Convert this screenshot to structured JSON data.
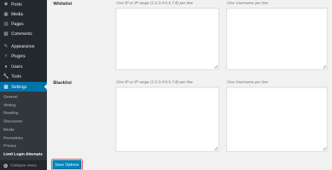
{
  "sidebar": {
    "items": [
      {
        "label": "Posts",
        "icon": "pin-icon"
      },
      {
        "label": "Media",
        "icon": "media-icon"
      },
      {
        "label": "Pages",
        "icon": "page-icon"
      },
      {
        "label": "Comments",
        "icon": "comment-icon"
      },
      {
        "label": "Appearance",
        "icon": "brush-icon"
      },
      {
        "label": "Plugins",
        "icon": "plug-icon"
      },
      {
        "label": "Users",
        "icon": "user-icon"
      },
      {
        "label": "Tools",
        "icon": "wrench-icon"
      },
      {
        "label": "Settings",
        "icon": "settings-icon",
        "active": true
      }
    ],
    "submenu": [
      {
        "label": "General"
      },
      {
        "label": "Writing"
      },
      {
        "label": "Reading"
      },
      {
        "label": "Discussion"
      },
      {
        "label": "Media"
      },
      {
        "label": "Permalinks"
      },
      {
        "label": "Privacy"
      },
      {
        "label": "Limit Login Attempts",
        "current": true
      }
    ],
    "collapse_label": "Collapse menu"
  },
  "form": {
    "whitelist": {
      "label": "Whitelist",
      "ip_hint": "One IP or IP range (1.2.3.4-5.6.7.8) per line",
      "user_hint": "One Username per line",
      "ip_value": "",
      "user_value": ""
    },
    "blacklist": {
      "label": "Blacklist",
      "ip_hint": "One IP or IP range (1.2.3.4-5.6.7.8) per line",
      "user_hint": "One Username per line",
      "ip_value": "",
      "user_value": ""
    },
    "save_label": "Save Options"
  },
  "colors": {
    "sidebar_bg": "#23282d",
    "submenu_bg": "#32373c",
    "accent": "#0073aa",
    "button": "#0085ba",
    "highlight": "#dc3232"
  }
}
